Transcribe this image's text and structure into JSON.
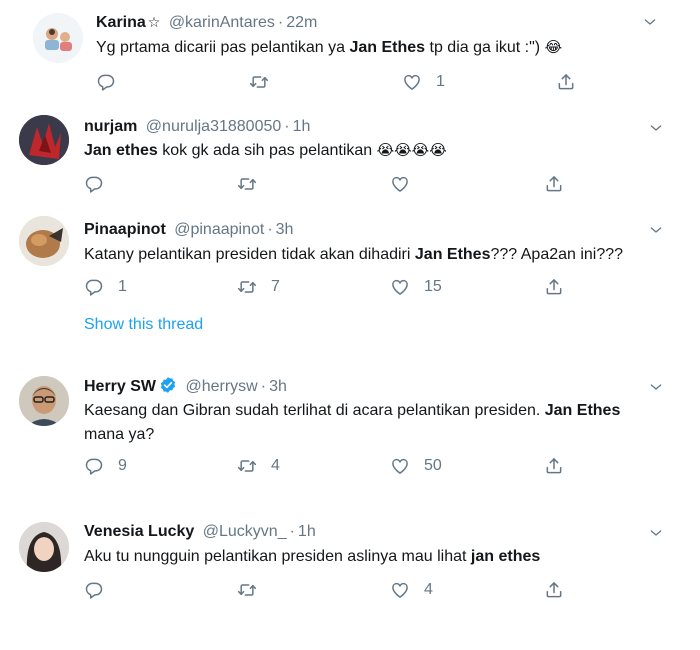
{
  "tweets": [
    {
      "name": "Karina",
      "name_suffix": "☆",
      "handle": "@karinAntares",
      "time": "22m",
      "text_before": "Yg prtama dicarii pas pelantikan ya ",
      "text_bold": "Jan Ethes",
      "text_after": " tp dia ga ikut :\") ",
      "emoji": "😂",
      "reply_count": "",
      "retweet_count": "",
      "like_count": "1"
    },
    {
      "name": "nurjam",
      "handle": "@nurulja31880050",
      "time": "1h",
      "text_before": "",
      "text_bold": "Jan ethes",
      "text_after": " kok gk ada sih pas pelantikan ",
      "emoji": "😭😭😭😭",
      "reply_count": "",
      "retweet_count": "",
      "like_count": ""
    },
    {
      "name": "Pinaapinot",
      "handle": "@pinaapinot",
      "time": "3h",
      "text_before": "Katany pelantikan presiden tidak akan dihadiri ",
      "text_bold": "Jan Ethes",
      "text_after": "??? Apa2an ini???",
      "reply_count": "1",
      "retweet_count": "7",
      "like_count": "15"
    },
    {
      "name": "Herry SW",
      "handle": "@herrysw",
      "time": "3h",
      "text_line1": "Kaesang dan Gibran sudah terlihat di acara pelantikan presiden. ",
      "text_bold": "Jan Ethes",
      "text_line2": "mana ya?",
      "reply_count": "9",
      "retweet_count": "4",
      "like_count": "50"
    },
    {
      "name": "Venesia Lucky",
      "handle": "@Luckyvn_",
      "time": "1h",
      "text_before": "Aku tu nungguin pelantikan presiden aslinya mau lihat ",
      "text_bold": "jan ethes",
      "text_after": "",
      "reply_count": "",
      "retweet_count": "",
      "like_count": "4"
    }
  ],
  "show_thread": "Show this thread",
  "colors": {
    "text": "#14171a",
    "muted": "#657786",
    "link": "#1da1f2",
    "verified": "#1da1f2"
  },
  "icons": [
    "reply-icon",
    "retweet-icon",
    "like-icon",
    "share-icon",
    "chevron-down-icon",
    "verified-badge-icon"
  ]
}
